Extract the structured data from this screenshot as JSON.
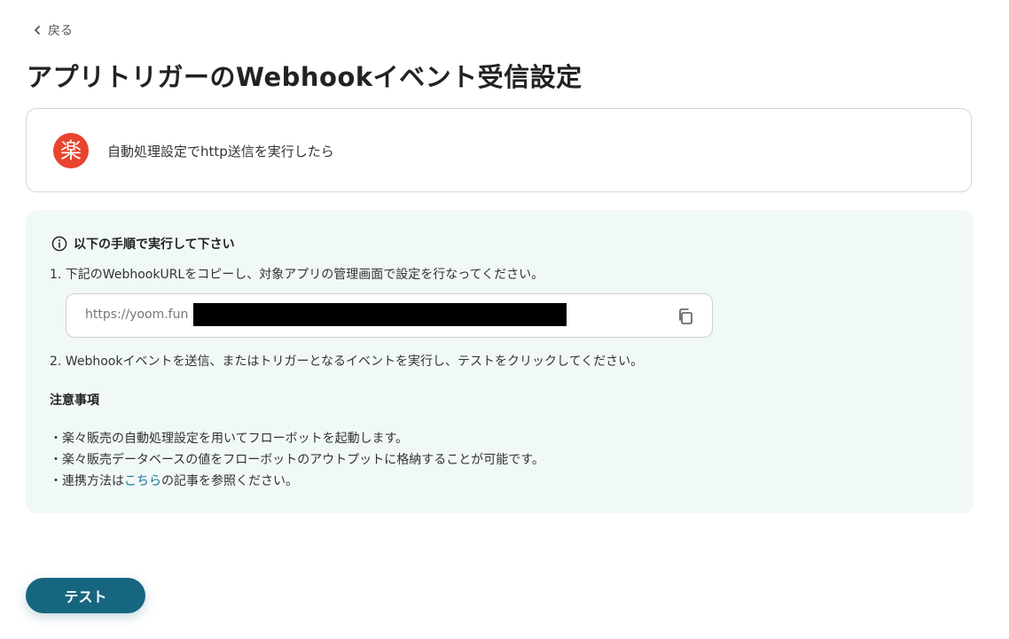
{
  "nav": {
    "back_label": "戻る"
  },
  "page": {
    "title": "アプリトリガーのWebhookイベント受信設定"
  },
  "app_card": {
    "logo_char": "楽",
    "logo_color": "#e8442f",
    "label": "自動処理設定でhttp送信を実行したら"
  },
  "instructions": {
    "heading": "以下の手順で実行して下さい",
    "step1": "1. 下記のWebhookURLをコピーし、対象アプリの管理画面で設定を行なってください。",
    "url_visible_prefix": "https://yoom.fun",
    "step2": "2. Webhookイベントを送信、またはトリガーとなるイベントを実行し、テストをクリックしてください。"
  },
  "notes": {
    "title": "注意事項",
    "item1": "・楽々販売の自動処理設定を用いてフローボットを起動します。",
    "item2": "・楽々販売データベースの値をフローボットのアウトプットに格納することが可能です。",
    "item3_prefix": "・連携方法は",
    "item3_link": "こちら",
    "item3_suffix": "の記事を参照ください。"
  },
  "actions": {
    "test_label": "テスト"
  },
  "colors": {
    "accent": "#176680",
    "panel_bg": "#f1f8f8",
    "link": "#1e7891"
  }
}
